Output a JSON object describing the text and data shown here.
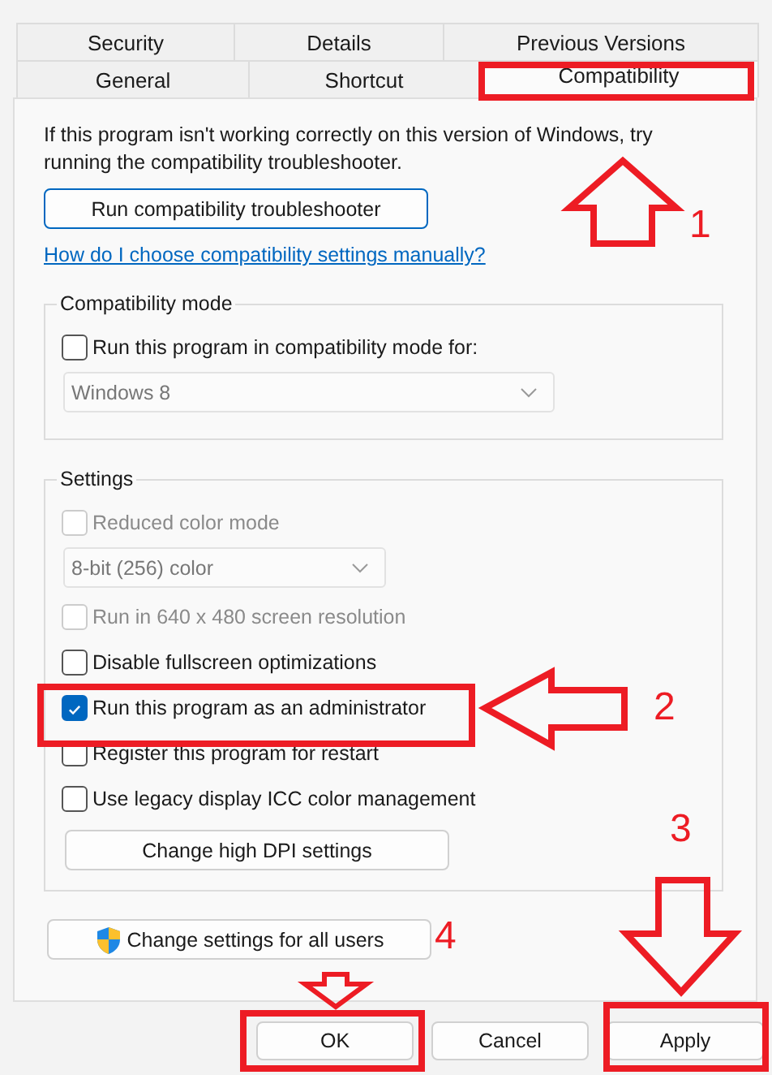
{
  "tabs": [
    [
      {
        "label": "Security",
        "selected": false
      },
      {
        "label": "Details",
        "selected": false
      },
      {
        "label": "Previous Versions",
        "selected": false
      }
    ],
    [
      {
        "label": "General",
        "selected": false
      },
      {
        "label": "Shortcut",
        "selected": false
      },
      {
        "label": "Compatibility",
        "selected": true
      }
    ]
  ],
  "intro": "If this program isn't working correctly on this version of Windows, try running the compatibility troubleshooter.",
  "troubleshooter_button": "Run compatibility troubleshooter",
  "help_link": "How do I choose compatibility settings manually?",
  "groups": [
    {
      "title": "Compatibility mode",
      "items": [
        {
          "kind": "checkbox",
          "label": "Run this program in compatibility mode for:",
          "checked": false,
          "disabled": false
        },
        {
          "kind": "dropdown",
          "value": "Windows 8",
          "disabled": true,
          "wide": true
        }
      ]
    },
    {
      "title": "Settings",
      "items": [
        {
          "kind": "checkbox",
          "label": "Reduced color mode",
          "checked": false,
          "disabled": true
        },
        {
          "kind": "dropdown",
          "value": "8-bit (256) color",
          "disabled": true,
          "wide": false
        },
        {
          "kind": "checkbox",
          "label": "Run in 640 x 480 screen resolution",
          "checked": false,
          "disabled": true
        },
        {
          "kind": "checkbox",
          "label": "Disable fullscreen optimizations",
          "checked": false,
          "disabled": false
        },
        {
          "kind": "checkbox",
          "label": "Run this program as an administrator",
          "checked": true,
          "disabled": false
        },
        {
          "kind": "checkbox",
          "label": "Register this program for restart",
          "checked": false,
          "disabled": false
        },
        {
          "kind": "checkbox",
          "label": "Use legacy display ICC color management",
          "checked": false,
          "disabled": false
        },
        {
          "kind": "button",
          "label": "Change high DPI settings"
        }
      ]
    }
  ],
  "all_users_button": "Change settings for all users",
  "dialog_buttons": [
    "OK",
    "Cancel",
    "Apply"
  ],
  "annotations": [
    "1",
    "2",
    "3",
    "4"
  ]
}
